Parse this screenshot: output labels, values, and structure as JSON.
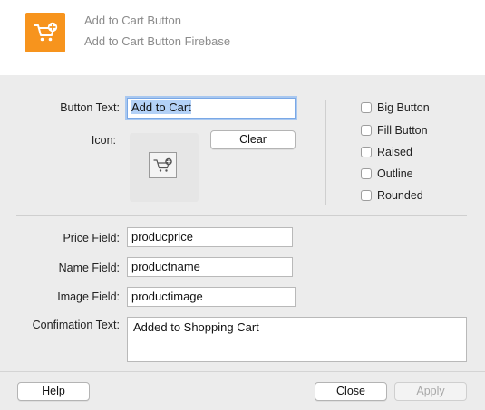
{
  "header": {
    "title": "Add to Cart Button",
    "subtitle": "Add to Cart Button Firebase",
    "icon": "cart-plus-icon",
    "accent": "#f7941d"
  },
  "form": {
    "button_text_label": "Button Text:",
    "button_text_value": "Add to Cart",
    "icon_label": "Icon:",
    "clear_label": "Clear",
    "price_label": "Price Field:",
    "price_value": "producprice",
    "name_label": "Name Field:",
    "name_value": "productname",
    "image_label": "Image Field:",
    "image_value": "productimage",
    "confirm_label": "Confimation Text:",
    "confirm_value": "Added to Shopping Cart"
  },
  "options": [
    {
      "label": "Big Button",
      "checked": false
    },
    {
      "label": "Fill Button",
      "checked": false
    },
    {
      "label": "Raised",
      "checked": false
    },
    {
      "label": "Outline",
      "checked": false
    },
    {
      "label": "Rounded",
      "checked": false
    }
  ],
  "footer": {
    "help_label": "Help",
    "close_label": "Close",
    "apply_label": "Apply"
  }
}
